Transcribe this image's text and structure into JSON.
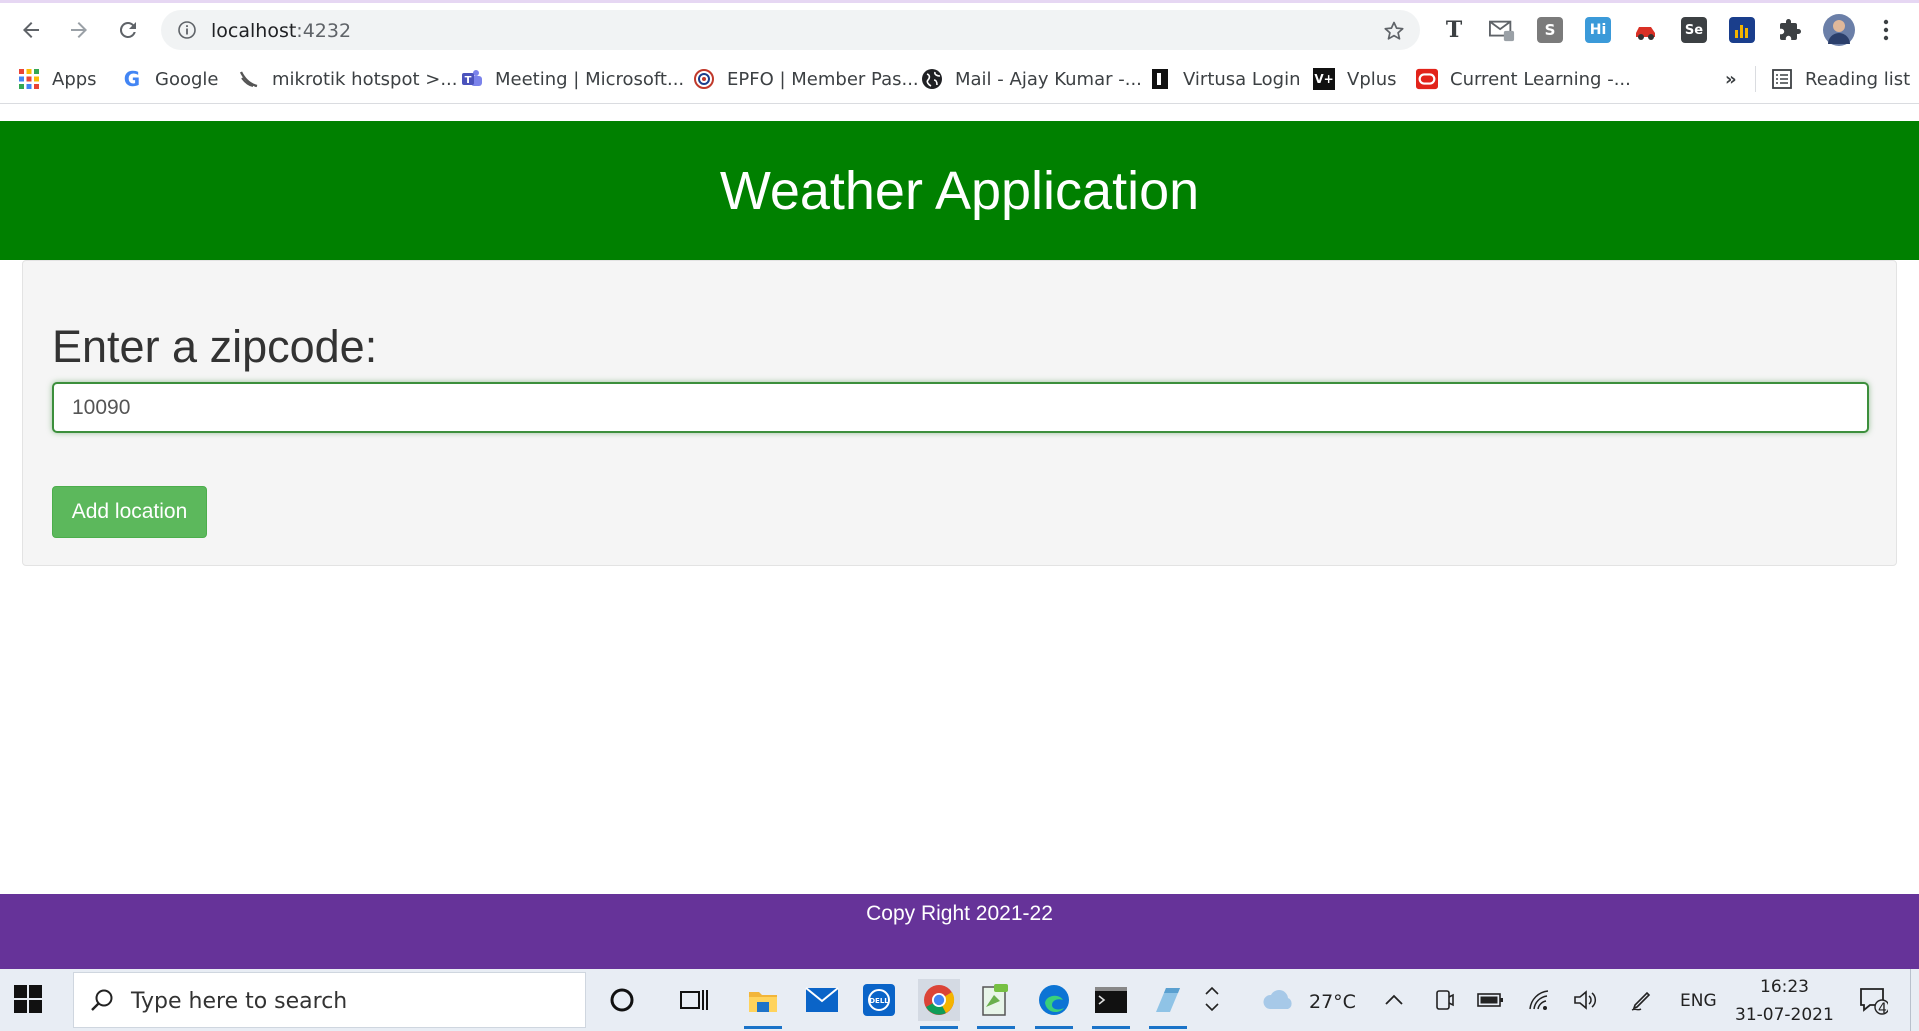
{
  "browser": {
    "url_host": "localhost",
    "url_port": ":4232",
    "bookmarks": [
      {
        "label": "Apps",
        "icon": "apps-grid-icon"
      },
      {
        "label": "Google",
        "icon": "google-icon"
      },
      {
        "label": "mikrotik hotspot >...",
        "icon": "mikrotik-icon"
      },
      {
        "label": "Meeting | Microsoft...",
        "icon": "teams-icon"
      },
      {
        "label": "EPFO | Member Pas...",
        "icon": "epfo-icon"
      },
      {
        "label": "Mail - Ajay Kumar -...",
        "icon": "globe-icon"
      },
      {
        "label": "Virtusa Login",
        "icon": "virtusa-icon"
      },
      {
        "label": "Vplus",
        "icon": "vplus-icon"
      },
      {
        "label": "Current Learning -...",
        "icon": "oracle-icon"
      }
    ],
    "more_bookmarks": "»",
    "reading_list": "Reading list"
  },
  "app": {
    "title": "Weather Application",
    "zip_label": "Enter a zipcode:",
    "zip_value": "10090",
    "add_button": "Add location",
    "footer": "Copy Right 2021-22",
    "colors": {
      "header": "#008000",
      "footer": "#663399",
      "button": "#5cb85c"
    }
  },
  "taskbar": {
    "search_placeholder": "Type here to search",
    "temperature": "27°C",
    "language": "ENG",
    "time": "16:23",
    "date": "31-07-2021",
    "notifications": "4"
  }
}
